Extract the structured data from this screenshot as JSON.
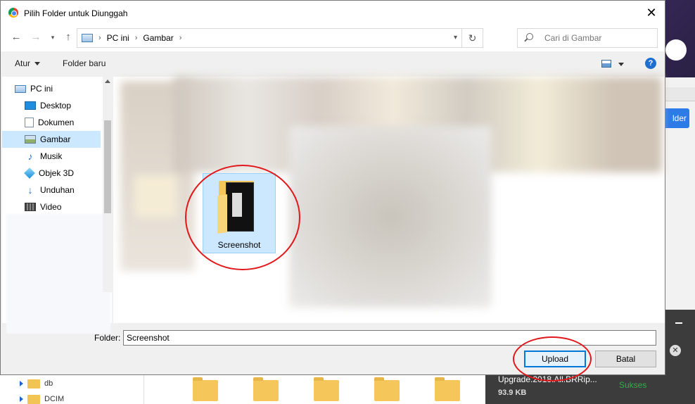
{
  "dialog": {
    "title": "Pilih Folder untuk Diunggah",
    "close_label": "✕"
  },
  "nav": {
    "back_icon": "arrow-left-icon",
    "forward_icon": "arrow-right-icon",
    "up_icon": "arrow-up-icon",
    "breadcrumb": [
      "PC ini",
      "Gambar"
    ],
    "search_placeholder": "Cari di Gambar"
  },
  "toolbar": {
    "organize_label": "Atur",
    "new_folder_label": "Folder baru",
    "help_label": "?"
  },
  "sidebar": {
    "items": [
      {
        "label": "PC ini",
        "icon": "computer-icon"
      },
      {
        "label": "Desktop",
        "icon": "desktop-icon"
      },
      {
        "label": "Dokumen",
        "icon": "documents-icon"
      },
      {
        "label": "Gambar",
        "icon": "pictures-icon",
        "selected": true
      },
      {
        "label": "Musik",
        "icon": "music-icon"
      },
      {
        "label": "Objek 3D",
        "icon": "objects-3d-icon"
      },
      {
        "label": "Unduhan",
        "icon": "downloads-icon"
      },
      {
        "label": "Video",
        "icon": "videos-icon"
      }
    ]
  },
  "content": {
    "selected_folder": "Screenshot"
  },
  "footer": {
    "folder_label": "Folder:",
    "folder_value": "Screenshot",
    "upload_label": "Upload",
    "cancel_label": "Batal"
  },
  "background": {
    "tree": [
      "db",
      "DCIM"
    ],
    "side_button": "lder",
    "download": {
      "file": "Upgrade.2018.All.BRRip...",
      "size": "93.9 KB",
      "status": "Sukses"
    }
  },
  "colors": {
    "accent": "#0078d7",
    "selection": "#cce8ff",
    "annotation": "#e0181b"
  }
}
